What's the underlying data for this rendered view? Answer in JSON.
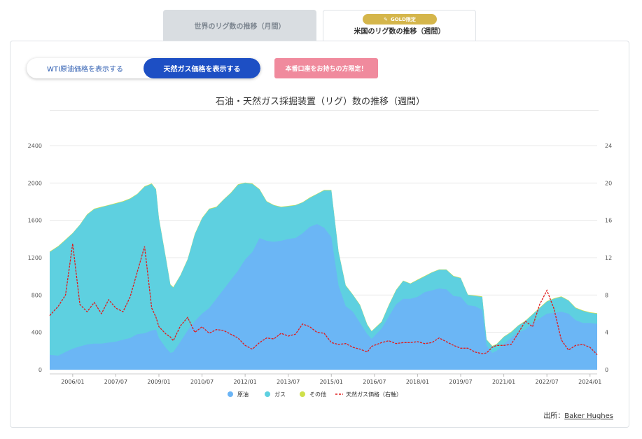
{
  "tabs": {
    "world": "世界のリグ数の推移（月間）",
    "us": "米国のリグ数の推移（週間）",
    "gold_badge": "GOLD限定"
  },
  "toggle": {
    "wti": "WTI原油価格を表示する",
    "gas": "天然ガス価格を表示する"
  },
  "promo": "本番口座をお持ちの方限定！",
  "source": {
    "label": "出所：",
    "link": "Baker Hughes"
  },
  "colors": {
    "oil": "#6bb4f5",
    "gas": "#5ed0e0",
    "other": "#cfe04a",
    "price": "#e01b1b",
    "accent": "#1d4fc4"
  },
  "chart_data": {
    "type": "area",
    "title": "石油・天然ガス採掘装置（リグ）数の推移（週間）",
    "x_ticks": [
      "2006/01",
      "2007/07",
      "2009/01",
      "2010/07",
      "2012/01",
      "2013/07",
      "2015/01",
      "2016/07",
      "2018/01",
      "2019/07",
      "2021/01",
      "2022/07",
      "2024/01"
    ],
    "y_left_ticks": [
      0,
      400,
      800,
      1200,
      1600,
      2000,
      2400
    ],
    "y_right_ticks": [
      0,
      4,
      8,
      12,
      16,
      20,
      24
    ],
    "ylim_left": [
      0,
      2400
    ],
    "ylim_right": [
      0,
      24
    ],
    "legend": [
      "原油",
      "ガス",
      "その他",
      "天然ガス価格（右軸）"
    ],
    "x": [
      2005.2,
      2005.5,
      2005.75,
      2006.0,
      2006.25,
      2006.5,
      2006.75,
      2007.0,
      2007.25,
      2007.5,
      2007.75,
      2008.0,
      2008.25,
      2008.5,
      2008.75,
      2008.9,
      2009.0,
      2009.25,
      2009.4,
      2009.5,
      2009.75,
      2010.0,
      2010.25,
      2010.5,
      2010.75,
      2011.0,
      2011.25,
      2011.5,
      2011.75,
      2012.0,
      2012.25,
      2012.5,
      2012.75,
      2013.0,
      2013.25,
      2013.5,
      2013.75,
      2014.0,
      2014.25,
      2014.5,
      2014.75,
      2015.0,
      2015.25,
      2015.5,
      2015.75,
      2016.0,
      2016.25,
      2016.4,
      2016.75,
      2017.0,
      2017.25,
      2017.5,
      2017.75,
      2018.0,
      2018.25,
      2018.5,
      2018.75,
      2019.0,
      2019.25,
      2019.5,
      2019.75,
      2020.0,
      2020.25,
      2020.4,
      2020.6,
      2020.75,
      2021.0,
      2021.25,
      2021.5,
      2021.75,
      2022.0,
      2022.25,
      2022.5,
      2022.75,
      2023.0,
      2023.25,
      2023.5,
      2023.75,
      2024.0,
      2024.25
    ],
    "series": [
      {
        "name": "原油",
        "values": [
          160,
          150,
          190,
          225,
          250,
          270,
          280,
          280,
          290,
          300,
          320,
          340,
          380,
          390,
          420,
          430,
          340,
          230,
          180,
          190,
          300,
          420,
          520,
          600,
          660,
          760,
          860,
          960,
          1060,
          1180,
          1260,
          1410,
          1380,
          1370,
          1380,
          1400,
          1410,
          1460,
          1530,
          1560,
          1520,
          1420,
          900,
          680,
          620,
          500,
          380,
          330,
          440,
          570,
          700,
          760,
          760,
          780,
          830,
          850,
          870,
          860,
          790,
          780,
          690,
          680,
          640,
          260,
          180,
          200,
          275,
          340,
          400,
          430,
          500,
          550,
          600,
          610,
          620,
          600,
          530,
          500,
          500,
          490
        ]
      },
      {
        "name": "ガス",
        "values": [
          1260,
          1320,
          1390,
          1460,
          1550,
          1660,
          1720,
          1740,
          1760,
          1780,
          1800,
          1830,
          1880,
          1960,
          1990,
          1930,
          1620,
          1180,
          910,
          880,
          1010,
          1180,
          1450,
          1620,
          1720,
          1740,
          1820,
          1890,
          1980,
          2000,
          1990,
          1930,
          1800,
          1760,
          1740,
          1750,
          1760,
          1790,
          1840,
          1880,
          1920,
          1920,
          1260,
          900,
          800,
          690,
          480,
          410,
          510,
          690,
          850,
          950,
          920,
          960,
          1000,
          1040,
          1070,
          1070,
          1000,
          980,
          800,
          790,
          780,
          320,
          250,
          270,
          350,
          400,
          470,
          520,
          590,
          660,
          730,
          760,
          780,
          740,
          660,
          630,
          610,
          600
        ]
      },
      {
        "name": "その他",
        "values": [
          1265,
          1325,
          1395,
          1465,
          1555,
          1665,
          1725,
          1745,
          1765,
          1785,
          1805,
          1835,
          1885,
          1965,
          1995,
          1935,
          1625,
          1185,
          915,
          885,
          1015,
          1185,
          1455,
          1625,
          1725,
          1745,
          1825,
          1895,
          1985,
          2005,
          1995,
          1935,
          1805,
          1765,
          1745,
          1755,
          1765,
          1795,
          1845,
          1885,
          1925,
          1925,
          1265,
          905,
          805,
          695,
          485,
          415,
          515,
          695,
          855,
          955,
          925,
          965,
          1005,
          1045,
          1075,
          1075,
          1005,
          985,
          805,
          795,
          785,
          325,
          255,
          275,
          355,
          405,
          475,
          525,
          595,
          665,
          735,
          765,
          785,
          745,
          665,
          635,
          615,
          605
        ]
      },
      {
        "name": "天然ガス価格（右軸）",
        "axis": "right",
        "values": [
          5.8,
          6.8,
          8.0,
          13.5,
          7.0,
          6.2,
          7.2,
          6.0,
          7.5,
          6.6,
          6.2,
          7.8,
          10.5,
          13.2,
          6.6,
          5.6,
          4.6,
          3.8,
          3.5,
          3.1,
          4.7,
          5.6,
          4.0,
          4.6,
          3.9,
          4.3,
          4.2,
          3.8,
          3.4,
          2.6,
          2.2,
          2.9,
          3.4,
          3.3,
          3.9,
          3.6,
          3.8,
          4.9,
          4.6,
          4.0,
          3.9,
          2.9,
          2.7,
          2.8,
          2.4,
          2.2,
          1.9,
          2.5,
          2.9,
          3.1,
          2.8,
          2.9,
          2.9,
          3.0,
          2.8,
          2.9,
          3.4,
          3.0,
          2.6,
          2.3,
          2.3,
          1.9,
          1.7,
          1.8,
          2.4,
          2.6,
          2.6,
          2.7,
          3.9,
          5.2,
          4.6,
          7.0,
          8.5,
          6.5,
          3.2,
          2.1,
          2.6,
          2.7,
          2.4,
          1.6
        ]
      }
    ]
  }
}
